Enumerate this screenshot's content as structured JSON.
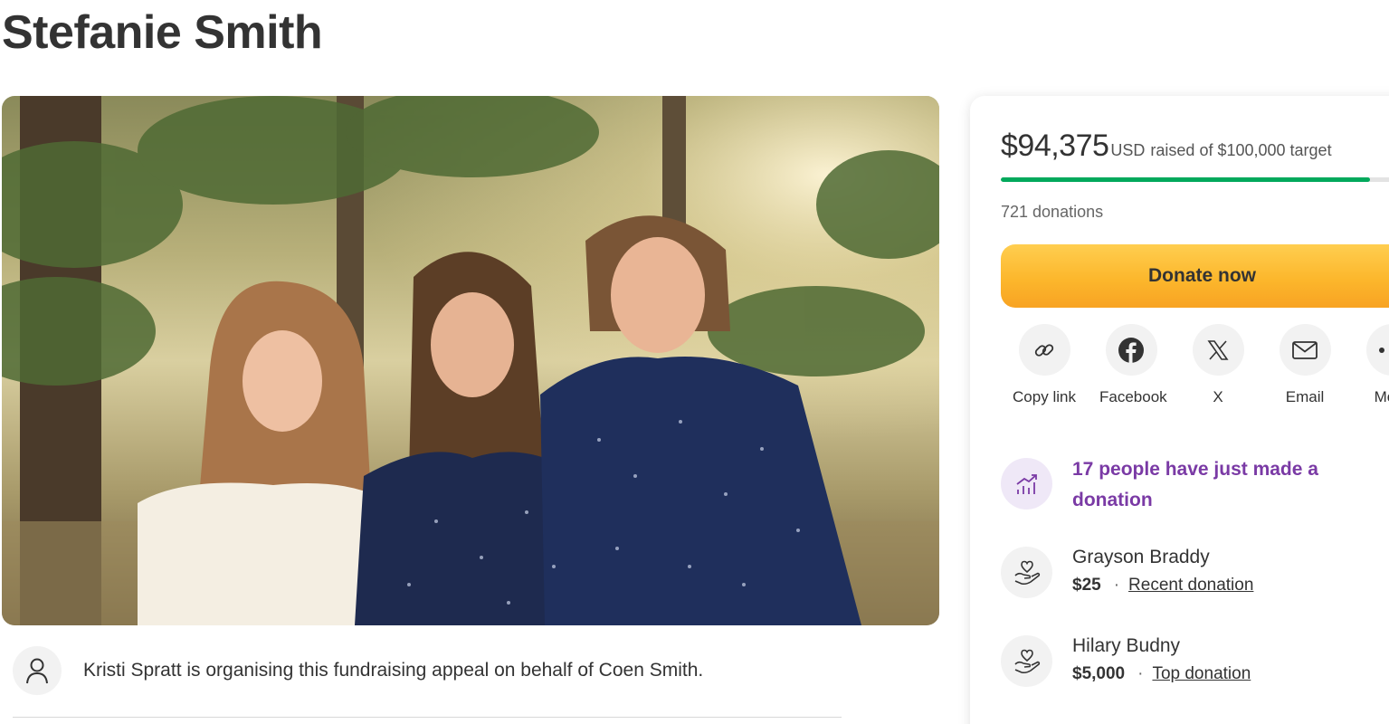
{
  "page": {
    "title": "Stefanie Smith"
  },
  "hero": {
    "alt": "Family photo of a woman with a young woman and a young man standing in front of pine trees"
  },
  "organiser": {
    "text": "Kristi Spratt is organising this fundraising appeal on behalf of Coen Smith.",
    "icon": "person-icon"
  },
  "sidebar": {
    "raised_amount": "$94,375",
    "raised_currency": "USD",
    "raised_rest": "raised of $100,000 target",
    "progress_fraction": 0.944,
    "progress_color": "#02a95c",
    "donation_count": "721 donations",
    "donate_label": "Donate now",
    "share": [
      {
        "label": "Copy link",
        "icon": "link-icon"
      },
      {
        "label": "Facebook",
        "icon": "facebook-icon"
      },
      {
        "label": "X",
        "icon": "x-logo-icon"
      },
      {
        "label": "Email",
        "icon": "mail-icon"
      },
      {
        "label": "More",
        "icon": "more-icon"
      }
    ],
    "notice": {
      "text": "17 people have just made a donation",
      "icon": "trending-up-icon",
      "color": "#7a3aa5"
    },
    "donors": [
      {
        "name": "Grayson Braddy",
        "amount": "$25",
        "tag": "Recent donation",
        "icon": "heart-hand-icon"
      },
      {
        "name": "Hilary Budny",
        "amount": "$5,000",
        "tag": "Top donation",
        "icon": "heart-hand-icon"
      }
    ]
  }
}
